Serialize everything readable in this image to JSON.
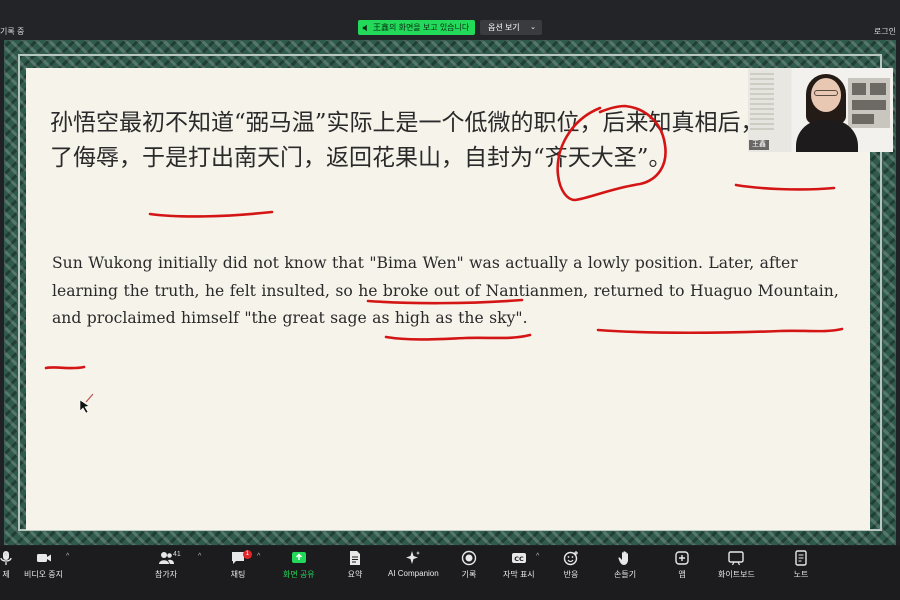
{
  "top_bar": {
    "recording_label": "기록 중",
    "share_banner": "王鑫의 화면을 보고 있습니다",
    "view_options": "옵션 보기",
    "login_label": "로그인"
  },
  "slide": {
    "zh_text": "孙悟空最初不知道“弼马温”实际上是一个低微的职位，后来知真相后，感到受到了侮辱，于是打出南天门，返回花果山，自封为“齐天大圣”。",
    "en_text": "Sun Wukong initially did not know that \"Bima Wen\" was actually a lowly position. Later, after learning the truth, he felt insulted, so he broke out of Nantianmen, returned to Huaguo Mountain, and proclaimed himself \"the great sage as high as the sky\"."
  },
  "self_video": {
    "participant_name": "王鑫"
  },
  "toolbar": {
    "items": [
      {
        "label": "제",
        "icon": "mic-icon"
      },
      {
        "label": "비디오 중지",
        "icon": "video-camera-icon"
      },
      {
        "label": "참가자",
        "icon": "participants-icon",
        "count": "41"
      },
      {
        "label": "채팅",
        "icon": "chat-icon",
        "badge": "1"
      },
      {
        "label": "화면 공유",
        "icon": "share-screen-icon"
      },
      {
        "label": "요약",
        "icon": "summary-icon"
      },
      {
        "label": "AI Companion",
        "icon": "sparkle-icon"
      },
      {
        "label": "기록",
        "icon": "record-icon"
      },
      {
        "label": "자막 표시",
        "icon": "cc-icon"
      },
      {
        "label": "반응",
        "icon": "reaction-icon"
      },
      {
        "label": "손들기",
        "icon": "raise-hand-icon"
      },
      {
        "label": "앱",
        "icon": "apps-icon"
      },
      {
        "label": "화이트보드",
        "icon": "whiteboard-icon"
      },
      {
        "label": "노트",
        "icon": "notes-icon"
      }
    ]
  },
  "colors": {
    "share_green": "#23d959",
    "annotation_red": "#d41515",
    "toolbar_bg": "#1c1c1e",
    "slide_bg": "#f6f3ea",
    "frame_green": "#2f5a4c"
  }
}
